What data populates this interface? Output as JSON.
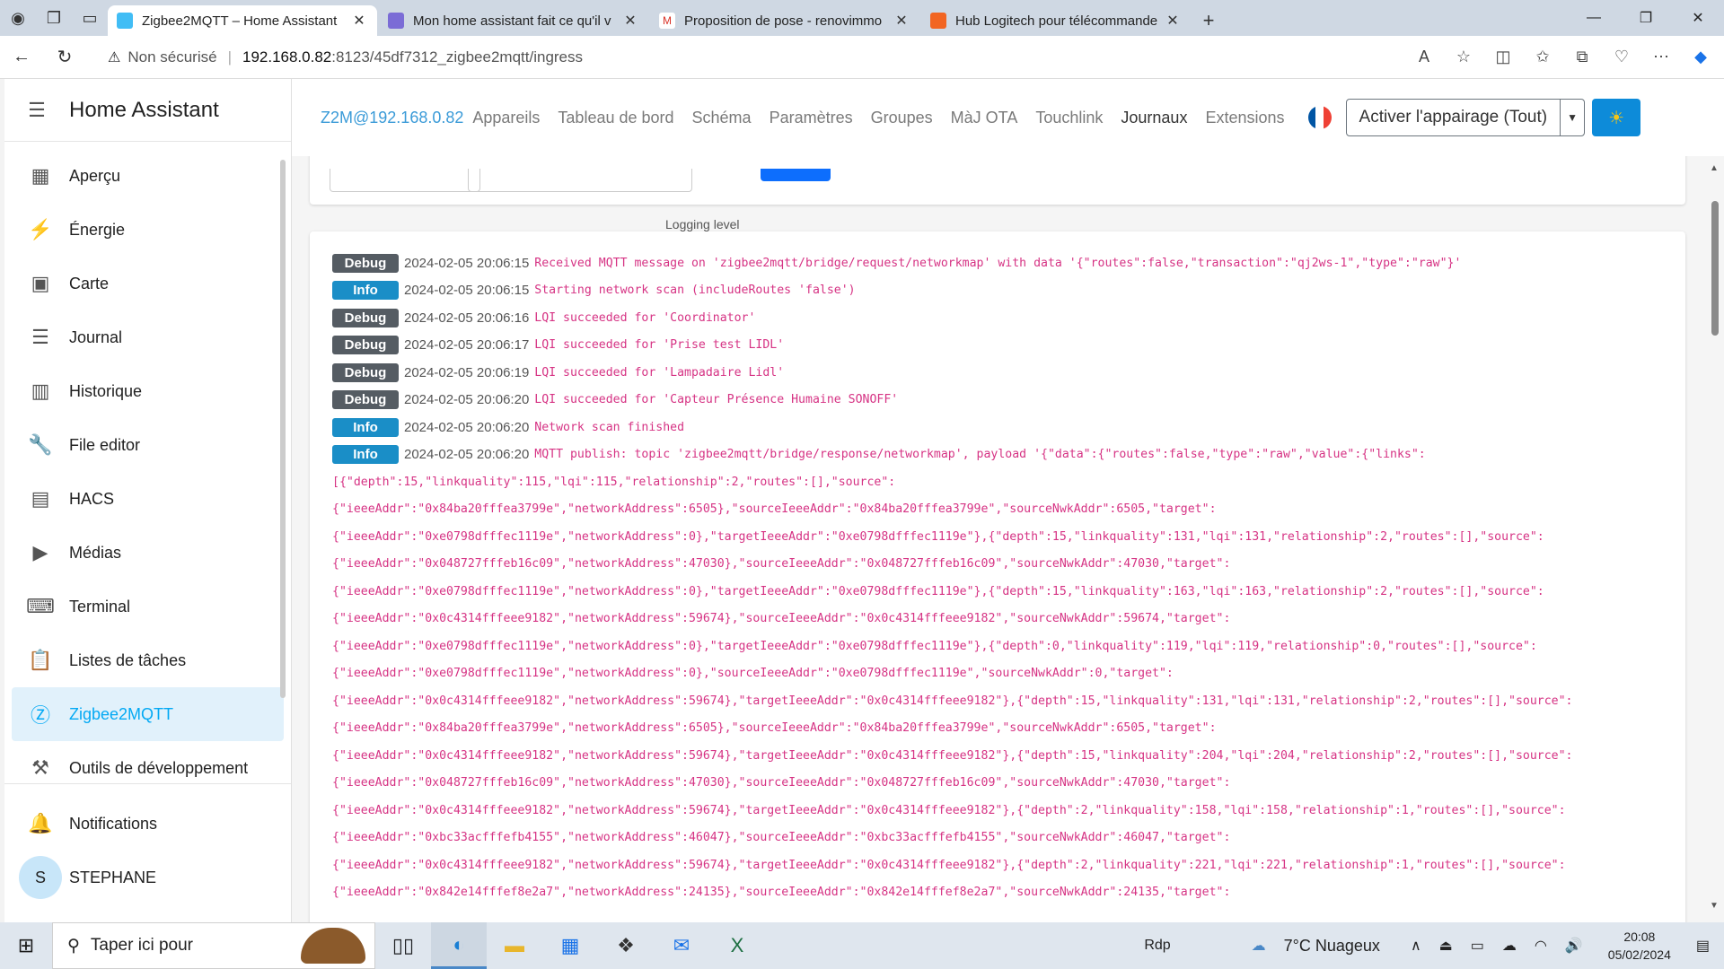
{
  "browser": {
    "tabs": [
      {
        "title": "Zigbee2MQTT – Home Assistant",
        "active": true,
        "fav_color": "#41bdf5"
      },
      {
        "title": "Mon home assistant fait ce qu'il v",
        "active": false,
        "fav_color": "#7b6cd6"
      },
      {
        "title": "Proposition de pose - renovimmo",
        "active": false,
        "fav_color": "#ffffff"
      },
      {
        "title": "Hub Logitech pour télécommande",
        "active": false,
        "fav_color": "#f26522"
      }
    ],
    "url": {
      "warning": "Non sécurisé",
      "host": "192.168.0.82",
      "path": ":8123/45df7312_zigbee2mqtt/ingress"
    }
  },
  "sidebar": {
    "title": "Home Assistant",
    "items": [
      {
        "label": "Aperçu",
        "icon": "dashboard-icon",
        "glyph": "▦"
      },
      {
        "label": "Énergie",
        "icon": "lightning-icon",
        "glyph": "⚡"
      },
      {
        "label": "Carte",
        "icon": "map-person-icon",
        "glyph": "▣"
      },
      {
        "label": "Journal",
        "icon": "list-icon",
        "glyph": "☰"
      },
      {
        "label": "Historique",
        "icon": "chart-icon",
        "glyph": "▥"
      },
      {
        "label": "File editor",
        "icon": "wrench-icon",
        "glyph": "🔧"
      },
      {
        "label": "HACS",
        "icon": "hacs-icon",
        "glyph": "▤"
      },
      {
        "label": "Médias",
        "icon": "media-icon",
        "glyph": "▶"
      },
      {
        "label": "Terminal",
        "icon": "terminal-icon",
        "glyph": "⌨"
      },
      {
        "label": "Listes de tâches",
        "icon": "clipboard-icon",
        "glyph": "📋"
      },
      {
        "label": "Zigbee2MQTT",
        "icon": "zigbee-icon",
        "glyph": "Ⓩ"
      },
      {
        "label": "Outils de développement",
        "icon": "hammer-icon",
        "glyph": "⚒"
      }
    ],
    "notifications": "Notifications",
    "user": {
      "initial": "S",
      "name": "STEPHANE"
    }
  },
  "z2m": {
    "brand": "Z2M@192.168.0.82",
    "nav": [
      "Appareils",
      "Tableau de bord",
      "Schéma",
      "Paramètres",
      "Groupes",
      "MàJ OTA",
      "Touchlink",
      "Journaux",
      "Extensions"
    ],
    "current": "Journaux",
    "pair_button": "Activer l'appairage (Tout)",
    "logging_level_label": "Logging level"
  },
  "logs": [
    {
      "level": "Debug",
      "time": "2024-02-05 20:06:15",
      "msg": "Received MQTT message on 'zigbee2mqtt/bridge/request/networkmap' with data '{\"routes\":false,\"transaction\":\"qj2ws-1\",\"type\":\"raw\"}'"
    },
    {
      "level": "Info",
      "time": "2024-02-05 20:06:15",
      "msg": "Starting network scan (includeRoutes 'false')"
    },
    {
      "level": "Debug",
      "time": "2024-02-05 20:06:16",
      "msg": "LQI succeeded for 'Coordinator'"
    },
    {
      "level": "Debug",
      "time": "2024-02-05 20:06:17",
      "msg": "LQI succeeded for 'Prise test LIDL'"
    },
    {
      "level": "Debug",
      "time": "2024-02-05 20:06:19",
      "msg": "LQI succeeded for 'Lampadaire Lidl'"
    },
    {
      "level": "Debug",
      "time": "2024-02-05 20:06:20",
      "msg": "LQI succeeded for 'Capteur Présence Humaine SONOFF'"
    },
    {
      "level": "Info",
      "time": "2024-02-05 20:06:20",
      "msg": "Network scan finished"
    },
    {
      "level": "Info",
      "time": "2024-02-05 20:06:20",
      "msg": "MQTT publish: topic 'zigbee2mqtt/bridge/response/networkmap', payload '{\"data\":{\"routes\":false,\"type\":\"raw\",\"value\":{\"links\":"
    }
  ],
  "continuation": [
    "[{\"depth\":15,\"linkquality\":115,\"lqi\":115,\"relationship\":2,\"routes\":[],\"source\":",
    "{\"ieeeAddr\":\"0x84ba20fffea3799e\",\"networkAddress\":6505},\"sourceIeeeAddr\":\"0x84ba20fffea3799e\",\"sourceNwkAddr\":6505,\"target\":",
    "{\"ieeeAddr\":\"0xe0798dfffec1119e\",\"networkAddress\":0},\"targetIeeeAddr\":\"0xe0798dfffec1119e\"},{\"depth\":15,\"linkquality\":131,\"lqi\":131,\"relationship\":2,\"routes\":[],\"source\":",
    "{\"ieeeAddr\":\"0x048727fffeb16c09\",\"networkAddress\":47030},\"sourceIeeeAddr\":\"0x048727fffeb16c09\",\"sourceNwkAddr\":47030,\"target\":",
    "{\"ieeeAddr\":\"0xe0798dfffec1119e\",\"networkAddress\":0},\"targetIeeeAddr\":\"0xe0798dfffec1119e\"},{\"depth\":15,\"linkquality\":163,\"lqi\":163,\"relationship\":2,\"routes\":[],\"source\":",
    "{\"ieeeAddr\":\"0x0c4314fffeee9182\",\"networkAddress\":59674},\"sourceIeeeAddr\":\"0x0c4314fffeee9182\",\"sourceNwkAddr\":59674,\"target\":",
    "{\"ieeeAddr\":\"0xe0798dfffec1119e\",\"networkAddress\":0},\"targetIeeeAddr\":\"0xe0798dfffec1119e\"},{\"depth\":0,\"linkquality\":119,\"lqi\":119,\"relationship\":0,\"routes\":[],\"source\":",
    "{\"ieeeAddr\":\"0xe0798dfffec1119e\",\"networkAddress\":0},\"sourceIeeeAddr\":\"0xe0798dfffec1119e\",\"sourceNwkAddr\":0,\"target\":",
    "{\"ieeeAddr\":\"0x0c4314fffeee9182\",\"networkAddress\":59674},\"targetIeeeAddr\":\"0x0c4314fffeee9182\"},{\"depth\":15,\"linkquality\":131,\"lqi\":131,\"relationship\":2,\"routes\":[],\"source\":",
    "{\"ieeeAddr\":\"0x84ba20fffea3799e\",\"networkAddress\":6505},\"sourceIeeeAddr\":\"0x84ba20fffea3799e\",\"sourceNwkAddr\":6505,\"target\":",
    "{\"ieeeAddr\":\"0x0c4314fffeee9182\",\"networkAddress\":59674},\"targetIeeeAddr\":\"0x0c4314fffeee9182\"},{\"depth\":15,\"linkquality\":204,\"lqi\":204,\"relationship\":2,\"routes\":[],\"source\":",
    "{\"ieeeAddr\":\"0x048727fffeb16c09\",\"networkAddress\":47030},\"sourceIeeeAddr\":\"0x048727fffeb16c09\",\"sourceNwkAddr\":47030,\"target\":",
    "{\"ieeeAddr\":\"0x0c4314fffeee9182\",\"networkAddress\":59674},\"targetIeeeAddr\":\"0x0c4314fffeee9182\"},{\"depth\":2,\"linkquality\":158,\"lqi\":158,\"relationship\":1,\"routes\":[],\"source\":",
    "{\"ieeeAddr\":\"0xbc33acfffefb4155\",\"networkAddress\":46047},\"sourceIeeeAddr\":\"0xbc33acfffefb4155\",\"sourceNwkAddr\":46047,\"target\":",
    "{\"ieeeAddr\":\"0x0c4314fffeee9182\",\"networkAddress\":59674},\"targetIeeeAddr\":\"0x0c4314fffeee9182\"},{\"depth\":2,\"linkquality\":221,\"lqi\":221,\"relationship\":1,\"routes\":[],\"source\":",
    "{\"ieeeAddr\":\"0x842e14fffef8e2a7\",\"networkAddress\":24135},\"sourceIeeeAddr\":\"0x842e14fffef8e2a7\",\"sourceNwkAddr\":24135,\"target\":"
  ],
  "taskbar": {
    "search_placeholder": "Taper ici pour",
    "rdp": "Rdp",
    "weather": "7°C  Nuageux",
    "time": "20:08",
    "date": "05/02/2024"
  },
  "colors": {
    "accent": "#03a9f4",
    "debug": "#555c63",
    "info": "#1a8ec7",
    "log_text": "#d63384"
  }
}
